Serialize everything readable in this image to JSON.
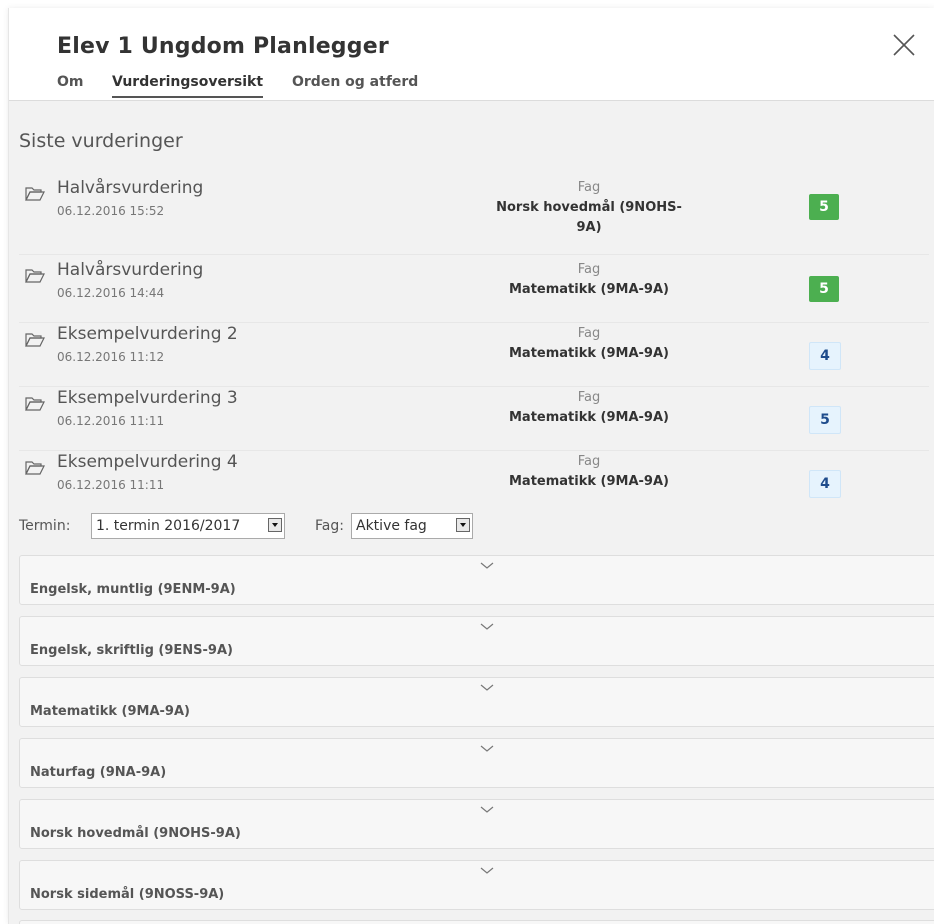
{
  "header": {
    "title": "Elev 1 Ungdom Planlegger",
    "tabs": [
      {
        "label": "Om"
      },
      {
        "label": "Vurderingsoversikt"
      },
      {
        "label": "Orden og atferd"
      }
    ],
    "close_icon": "close-icon"
  },
  "recent": {
    "title": "Siste vurderinger",
    "items": [
      {
        "name": "Halvårsvurdering",
        "date": "06.12.2016 15:52",
        "fag_label": "Fag",
        "fag": "Norsk hovedmål (9NOHS-9A)",
        "grade": "5",
        "grade_style": "green"
      },
      {
        "name": "Halvårsvurdering",
        "date": "06.12.2016 14:44",
        "fag_label": "Fag",
        "fag": "Matematikk (9MA-9A)",
        "grade": "5",
        "grade_style": "green"
      },
      {
        "name": "Eksempelvurdering 2",
        "date": "06.12.2016 11:12",
        "fag_label": "Fag",
        "fag": "Matematikk (9MA-9A)",
        "grade": "4",
        "grade_style": "blue"
      },
      {
        "name": "Eksempelvurdering 3",
        "date": "06.12.2016 11:11",
        "fag_label": "Fag",
        "fag": "Matematikk (9MA-9A)",
        "grade": "5",
        "grade_style": "blue"
      },
      {
        "name": "Eksempelvurdering 4",
        "date": "06.12.2016 11:11",
        "fag_label": "Fag",
        "fag": "Matematikk (9MA-9A)",
        "grade": "4",
        "grade_style": "blue"
      }
    ]
  },
  "filters": {
    "termin_label": "Termin:",
    "termin_value": "1. termin 2016/2017",
    "fag_label": "Fag:",
    "fag_value": "Aktive fag"
  },
  "subjects": [
    {
      "label": "Engelsk, muntlig (9ENM-9A)"
    },
    {
      "label": "Engelsk, skriftlig (9ENS-9A)"
    },
    {
      "label": "Matematikk (9MA-9A)"
    },
    {
      "label": "Naturfag (9NA-9A)"
    },
    {
      "label": "Norsk hovedmål (9NOHS-9A)"
    },
    {
      "label": "Norsk sidemål (9NOSS-9A)"
    }
  ],
  "colors": {
    "grade_green": "#4caf50",
    "grade_blue_bg": "#e6f3fd",
    "grade_blue_text": "#1f4c8c"
  }
}
